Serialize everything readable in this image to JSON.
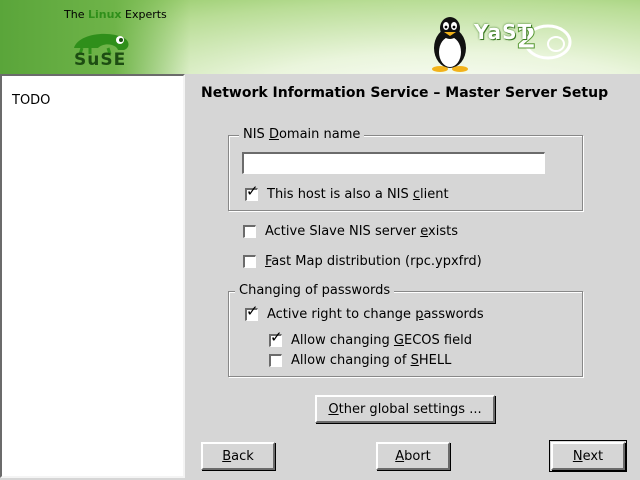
{
  "header": {
    "tagline_pre": "The ",
    "tagline_highlight": "Linux",
    "tagline_post": " Experts",
    "suse_brand": "SuSE",
    "yast_brand": "YaST",
    "yast_version": "2"
  },
  "help": {
    "text": "TODO"
  },
  "dialog": {
    "title": "Network Information Service – Master Server Setup",
    "domain_group": {
      "label_pre": "NIS ",
      "label_mn": "D",
      "label_post": "omain name",
      "value": "",
      "client_cb": {
        "pre": "This host is also a NIS ",
        "mn": "c",
        "post": "lient",
        "checked": true
      }
    },
    "slave_cb": {
      "pre": "Active Slave NIS server ",
      "mn": "e",
      "post": "xists",
      "checked": false
    },
    "fastmap_cb": {
      "pre": "",
      "mn": "F",
      "post": "ast Map distribution (rpc.ypxfrd)",
      "checked": false
    },
    "passwords_group": {
      "label": "Changing of passwords",
      "active_cb": {
        "pre": "Active right to change ",
        "mn": "p",
        "post": "asswords",
        "checked": true
      },
      "gecos_cb": {
        "pre": "Allow changing ",
        "mn": "G",
        "post": "ECOS field",
        "checked": true
      },
      "shell_cb": {
        "pre": "Allow changing of ",
        "mn": "S",
        "post": "HELL",
        "checked": false
      }
    },
    "other_button": {
      "pre": "",
      "mn": "O",
      "post": "ther global settings ..."
    }
  },
  "buttons": {
    "back": {
      "pre": "",
      "mn": "B",
      "post": "ack"
    },
    "abort": {
      "pre": "",
      "mn": "A",
      "post": "bort"
    },
    "next": {
      "pre": "",
      "mn": "N",
      "post": "ext"
    }
  },
  "colors": {
    "brand_green": "#6fb449",
    "panel_bg": "#d6d6d6"
  }
}
